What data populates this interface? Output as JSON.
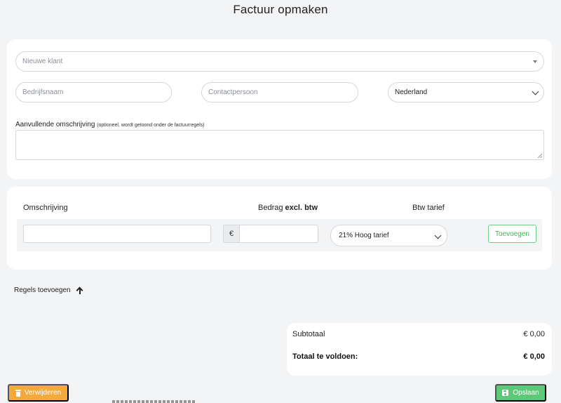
{
  "page": {
    "title": "Factuur opmaken"
  },
  "client": {
    "client_select_placeholder": "Nieuwe klant",
    "company_placeholder": "Bedrijfsnaam",
    "contact_placeholder": "Contactpersoon",
    "country_value": "Nederland",
    "description_label": "Aanvullende omschrijving",
    "description_hint": "(optioneel, wordt getoond onder de factuurregels)",
    "description_value": ""
  },
  "lines": {
    "headers": {
      "description": "Omschrijving",
      "amount_prefix": "Bedrag",
      "amount_bold": "excl. btw",
      "vat": "Btw tarief"
    },
    "row": {
      "description_value": "",
      "currency_symbol": "€",
      "amount_value": "",
      "vat_value": "21% Hoog tarief"
    },
    "add_button_label": "Toevoegen"
  },
  "add_rules": {
    "label": "Regels toevoegen",
    "icon": "arrow-up-icon"
  },
  "totals": {
    "subtotal_label": "Subtotaal",
    "subtotal_value": "€ 0,00",
    "grand_label": "Totaal te voldoen:",
    "grand_value": "€ 0,00"
  },
  "actions": {
    "delete_label": "Verwijderen",
    "delete_icon": "trash-icon",
    "save_label": "Opslaan",
    "save_icon": "floppy-icon"
  },
  "colors": {
    "background": "#f3f4f6",
    "card": "#ffffff",
    "delete": "#f4a93b",
    "save": "#5cc878",
    "add_button": "#3cb556"
  }
}
